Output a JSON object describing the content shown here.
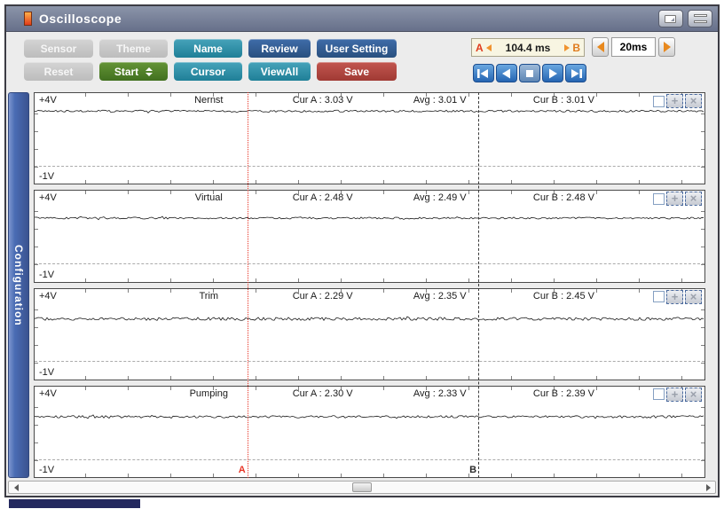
{
  "window": {
    "title": "Oscilloscope"
  },
  "colors": {
    "titlebar": "#67708a",
    "teal": "#1f7f97",
    "navy": "#29507f",
    "green": "#41701f",
    "red": "#a03a34",
    "disabled_gray": "#c6c6c6",
    "transport_blue": "#2565b2",
    "accent_orange": "#e8891e",
    "cursor_a_red": "#e83426",
    "config_blue": "#4a6cb4"
  },
  "icons": {
    "titlebar": [
      "restore-window-icon",
      "shade-window-icon"
    ],
    "transport": [
      "skip-start-icon",
      "step-back-icon",
      "stop-icon",
      "play-icon",
      "skip-end-icon"
    ],
    "timebase": [
      "left-arrow-icon",
      "right-arrow-icon"
    ],
    "start_spinner": [
      "up-arrow-icon",
      "down-arrow-icon"
    ],
    "scrollbar": [
      "left-arrow-icon",
      "right-arrow-icon"
    ]
  },
  "toolbar": {
    "row1": [
      {
        "label": "Sensor",
        "state": "disabled"
      },
      {
        "label": "Theme",
        "state": "disabled"
      },
      {
        "label": "Name",
        "state": "enabled"
      },
      {
        "label": "Review",
        "state": "enabled"
      },
      {
        "label": "User Setting",
        "state": "enabled"
      }
    ],
    "row2": [
      {
        "label": "Reset",
        "state": "disabled"
      },
      {
        "label": "Start",
        "state": "enabled"
      },
      {
        "label": "Cursor",
        "state": "enabled"
      },
      {
        "label": "ViewAll",
        "state": "enabled"
      },
      {
        "label": "Save",
        "state": "enabled"
      }
    ]
  },
  "time_controls": {
    "cursor_a": "A",
    "cursor_b": "B",
    "delta_value": "104.4 ms",
    "timebase": "20ms"
  },
  "sidebar": {
    "tab_label": "Configuration"
  },
  "panel_controls": {
    "plus_glyph": "+",
    "close_glyph": "×"
  },
  "cursor_labels": {
    "a": "A",
    "b": "B"
  },
  "channels": [
    {
      "name": "Nernst",
      "scale_top": "+4V",
      "scale_bottom": "-1V",
      "cur_a": "Cur A : 3.03 V",
      "avg": "Avg : 3.01 V",
      "cur_b": "Cur B : 3.01 V",
      "trace": {
        "volts": 3.01,
        "noise": 1.1
      }
    },
    {
      "name": "Virtual",
      "scale_top": "+4V",
      "scale_bottom": "-1V",
      "cur_a": "Cur A : 2.48 V",
      "avg": "Avg : 2.49 V",
      "cur_b": "Cur B : 2.48 V",
      "trace": {
        "volts": 2.49,
        "noise": 1.0
      }
    },
    {
      "name": "Trim",
      "scale_top": "+4V",
      "scale_bottom": "-1V",
      "cur_a": "Cur A : 2.29 V",
      "avg": "Avg : 2.35 V",
      "cur_b": "Cur B : 2.45 V",
      "trace": {
        "volts": 2.36,
        "noise": 1.7
      }
    },
    {
      "name": "Pumping",
      "scale_top": "+4V",
      "scale_bottom": "-1V",
      "cur_a": "Cur A : 2.30 V",
      "avg": "Avg : 2.33 V",
      "cur_b": "Cur B : 2.39 V",
      "trace": {
        "volts": 2.34,
        "noise": 1.3
      }
    }
  ]
}
